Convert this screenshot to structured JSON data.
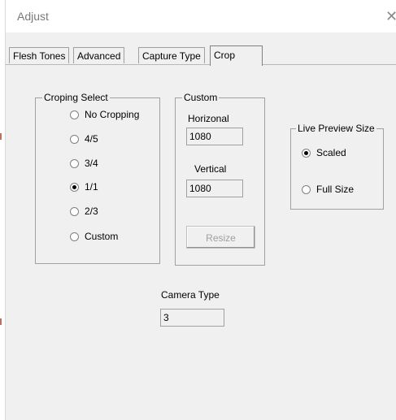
{
  "window": {
    "title": "Adjust",
    "close_glyph": "✕"
  },
  "tabs": [
    {
      "label": "Flesh Tones",
      "active": false
    },
    {
      "label": "Advanced",
      "active": false
    },
    {
      "label": "Capture Type",
      "active": false
    },
    {
      "label": "Crop",
      "active": true
    }
  ],
  "cropping": {
    "legend": "Croping Select",
    "options": [
      {
        "label": "No Cropping",
        "checked": false
      },
      {
        "label": "4/5",
        "checked": false
      },
      {
        "label": "3/4",
        "checked": false
      },
      {
        "label": "1/1",
        "checked": true
      },
      {
        "label": "2/3",
        "checked": false
      },
      {
        "label": "Custom",
        "checked": false
      }
    ]
  },
  "custom": {
    "legend": "Custom",
    "horizontal_label": "Horizonal",
    "horizontal_value": "1080",
    "vertical_label": "Vertical",
    "vertical_value": "1080",
    "resize_label": "Resize"
  },
  "preview": {
    "legend": "Live Preview Size",
    "options": [
      {
        "label": "Scaled",
        "checked": true
      },
      {
        "label": "Full Size",
        "checked": false
      }
    ]
  },
  "camera": {
    "label": "Camera Type",
    "value": "3"
  }
}
